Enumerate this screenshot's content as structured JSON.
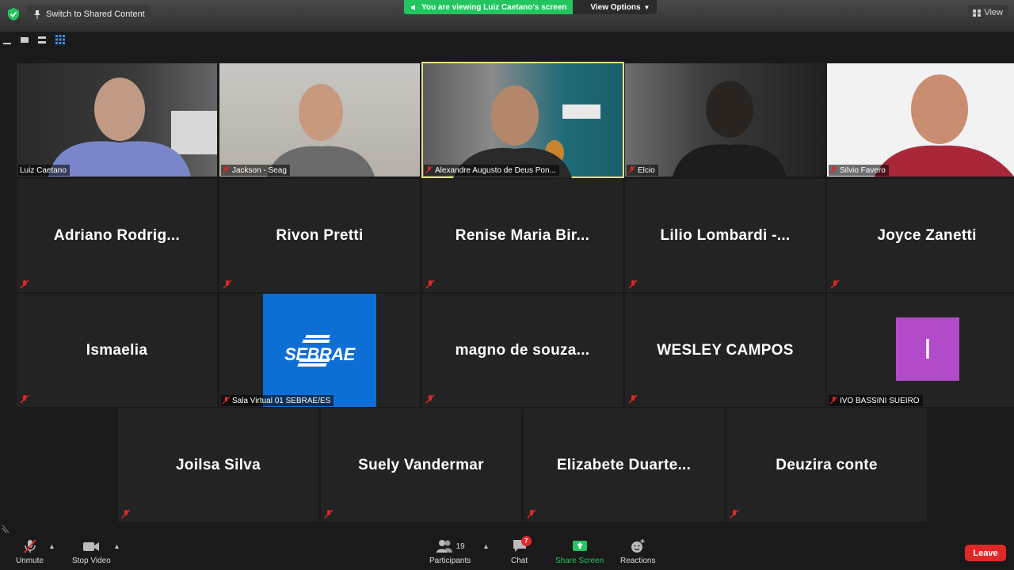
{
  "topbar": {
    "switch_label": "Switch to Shared Content",
    "banner_text": "You are viewing Luiz Caetano's screen",
    "view_options": "View Options",
    "view_label": "View"
  },
  "video_tiles": [
    {
      "name": "Luiz Caetano",
      "muted": false
    },
    {
      "name": "Jackson - Seag",
      "muted": true
    },
    {
      "name": "Alexandre Augusto de Deus Pon...",
      "muted": true,
      "active": true
    },
    {
      "name": "Elcio",
      "muted": true
    },
    {
      "name": "Silvio Favero",
      "muted": true
    }
  ],
  "name_tiles_row2": [
    {
      "name": "Adriano  Rodrig..."
    },
    {
      "name": "Rivon Pretti"
    },
    {
      "name": "Renise  Maria  Bir..."
    },
    {
      "name": "Lilio  Lombardi  -..."
    },
    {
      "name": "Joyce Zanetti"
    }
  ],
  "row3": {
    "ismaelia": "Ismaelia",
    "sebrae_logo": "SEBRAE",
    "sebrae_label": "Sala Virtual 01 SEBRAE/ES",
    "magno": "magno  de  souza...",
    "wesley": "WESLEY CAMPOS",
    "ivo_initial": "I",
    "ivo_label": "IVO BASSINI SUEIRO",
    "avatar_color": "#b24bc9"
  },
  "row4": [
    {
      "name": "Joilsa Silva"
    },
    {
      "name": "Suely Vandermar"
    },
    {
      "name": "Elizabete  Duarte..."
    },
    {
      "name": "Deuzira conte"
    }
  ],
  "more_label": "···",
  "toolbar": {
    "unmute": "Unmute",
    "stop_video": "Stop Video",
    "participants": "Participants",
    "participants_count": "19",
    "chat": "Chat",
    "chat_badge": "7",
    "share_screen": "Share Screen",
    "reactions": "Reactions",
    "leave": "Leave"
  },
  "colors": {
    "banner_green": "#23c55e",
    "share_green": "#23c55e",
    "leave_red": "#e02828",
    "sebrae_blue": "#0d6fd6",
    "active_border": "#e8e27a"
  }
}
